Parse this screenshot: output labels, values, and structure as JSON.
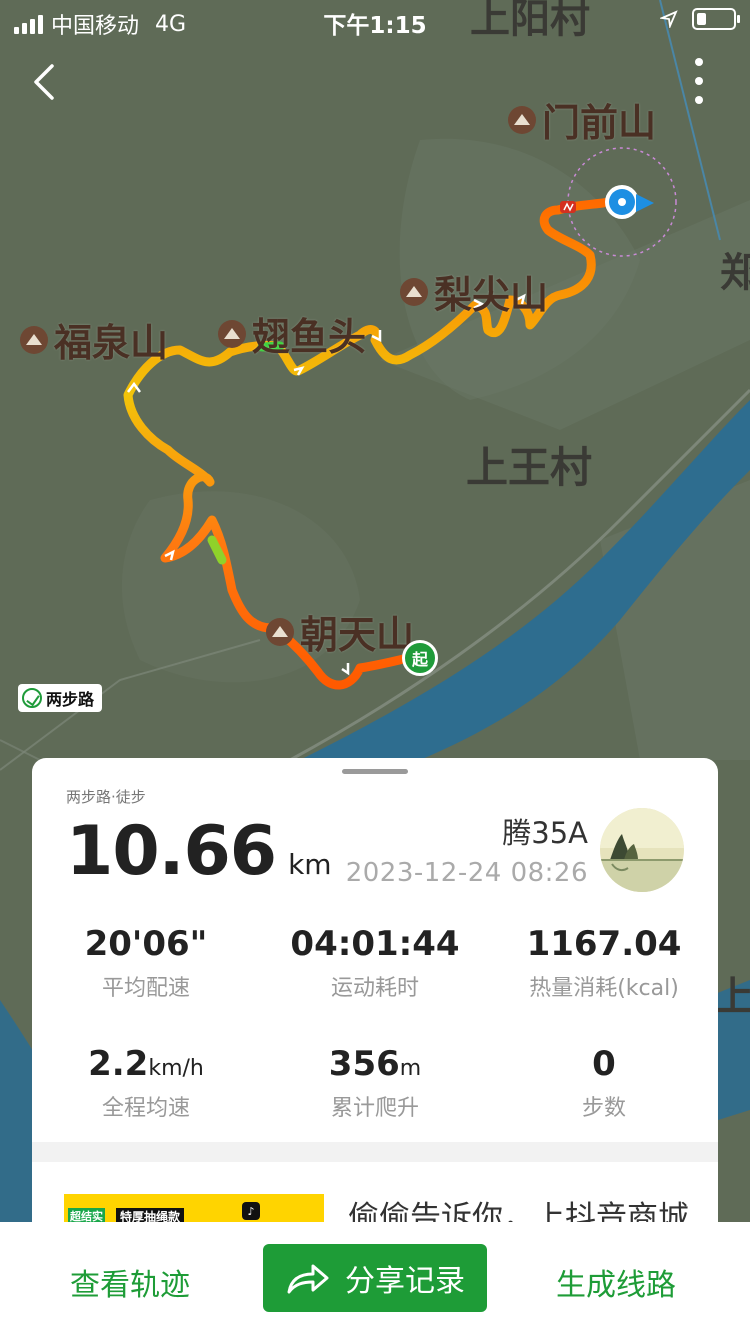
{
  "status_bar": {
    "carrier": "中国移动",
    "network": "4G",
    "time": "下午1:15"
  },
  "map": {
    "places": {
      "menqian": "门前山",
      "lijian": "梨尖山",
      "fuquan": "福泉山",
      "chiyu": "翅鱼头",
      "chaotian": "朝天山",
      "shangwang": "上王村",
      "shangyang": "上阳村",
      "edge_right": "郑",
      "edge_right2": "上"
    },
    "start_label": "起",
    "logo_text": "两步路"
  },
  "card": {
    "source": "两步路·徒步",
    "distance": "10.66",
    "distance_unit": "km",
    "user": "腾35A",
    "date": "2023-12-24 08:26",
    "stats": [
      {
        "value": "20'06\"",
        "unit": "",
        "label": "平均配速"
      },
      {
        "value": "04:01:44",
        "unit": "",
        "label": "运动耗时"
      },
      {
        "value": "1167.04",
        "unit": "",
        "label": "热量消耗(kcal)"
      },
      {
        "value": "2.2",
        "unit": "km/h",
        "label": "全程均速"
      },
      {
        "value": "356",
        "unit": "m",
        "label": "累计爬升"
      },
      {
        "value": "0",
        "unit": "",
        "label": "步数"
      }
    ]
  },
  "ad": {
    "title": "偷偷告诉你，上抖音商城",
    "tag1": "超结实",
    "tag2": "特厚抽绳款"
  },
  "bottom_bar": {
    "view_track": "查看轨迹",
    "share": "分享记录",
    "generate_route": "生成线路"
  }
}
